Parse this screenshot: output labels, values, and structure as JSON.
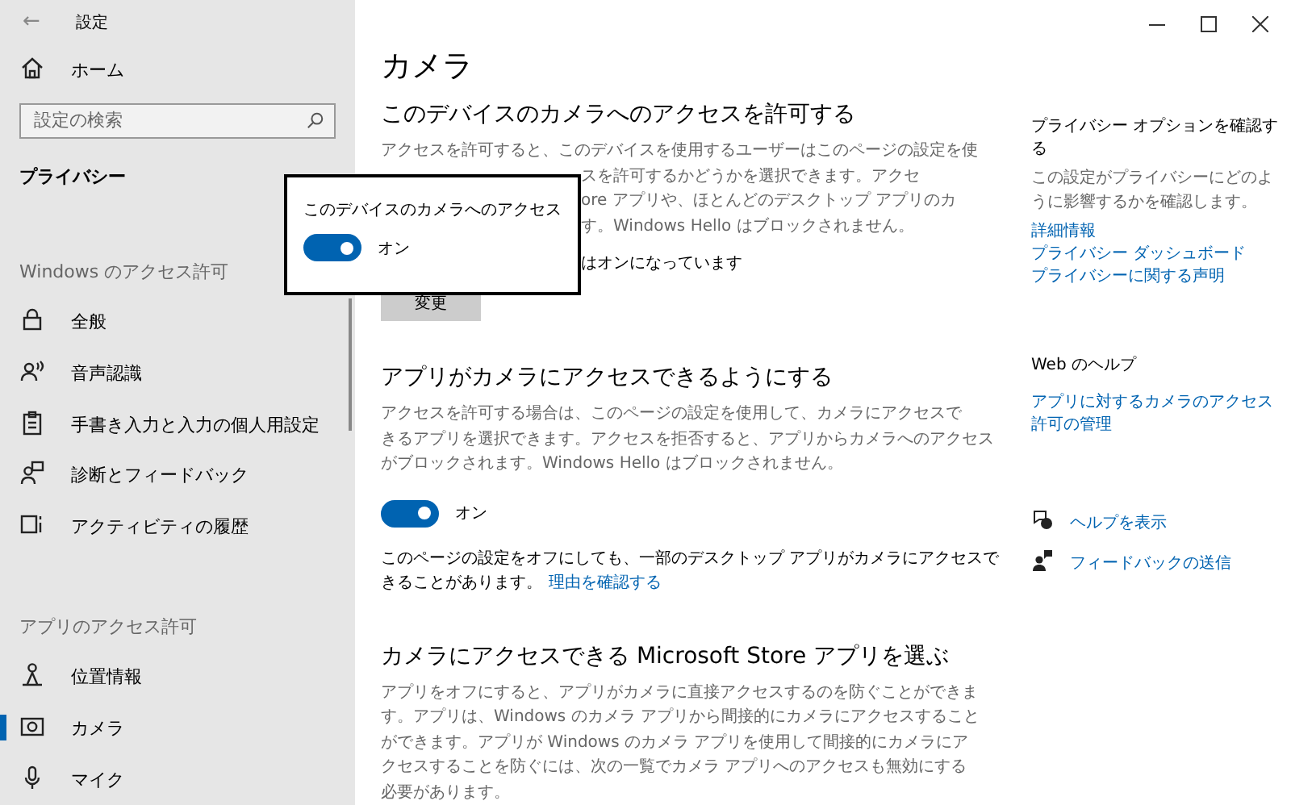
{
  "window": {
    "back": "←",
    "title": "設定"
  },
  "sidebar": {
    "home": "ホーム",
    "search": {
      "placeholder": "設定の検索"
    },
    "category": "プライバシー",
    "groups": [
      {
        "heading": "Windows のアクセス許可",
        "items": [
          {
            "label": "全般",
            "selected": false
          },
          {
            "label": "音声認識",
            "selected": false
          },
          {
            "label": "手書き入力と入力の個人用設定",
            "selected": false
          },
          {
            "label": "診断とフィードバック",
            "selected": false
          },
          {
            "label": "アクティビティの履歴",
            "selected": false
          }
        ]
      },
      {
        "heading": "アプリのアクセス許可",
        "items": [
          {
            "label": "位置情報",
            "selected": false
          },
          {
            "label": "カメラ",
            "selected": true
          },
          {
            "label": "マイク",
            "selected": false
          }
        ]
      }
    ]
  },
  "main": {
    "title": "カメラ",
    "device_access": {
      "heading": "このデバイスのカメラへのアクセスを許可する",
      "first_line": "アクセスを許可すると、このデバイスを使用するユーザーはこのページの設定を使",
      "visible_fragments": [
        "スを許可するかどうかを選択できます。アクセ",
        "ore アプリや、ほとんどのデスクトップ アプリのカ",
        "す。Windows Hello はブロックされません。"
      ],
      "status_fragment": "はオンになっています",
      "button": "変更"
    },
    "app_access": {
      "heading": "アプリがカメラにアクセスできるようにする",
      "description_lines": [
        "アクセスを許可する場合は、このページの設定を使用して、カメラにアクセスで",
        "きるアプリを選択できます。アクセスを拒否すると、アプリからカメラへのアクセス",
        "がブロックされます。Windows Hello はブロックされません。"
      ],
      "toggle": {
        "on": true,
        "label": "オン"
      },
      "note_lines": [
        "このページの設定をオフにしても、一部のデスクトップ アプリがカメラにアクセスで",
        "きることがあります。"
      ],
      "note_link": "理由を確認する"
    },
    "store_apps": {
      "heading": "カメラにアクセスできる Microsoft Store アプリを選ぶ",
      "description_lines": [
        "アプリをオフにすると、アプリがカメラに直接アクセスするのを防ぐことができま",
        "す。アプリは、Windows のカメラ アプリから間接的にカメラにアクセスすること",
        "ができます。アプリが Windows のカメラ アプリを使用して間接的にカメラにア",
        "クセスすることを防ぐには、次の一覧でカメラ アプリへのアクセスも無効にする",
        "必要があります。"
      ]
    }
  },
  "popup": {
    "label": "このデバイスのカメラへのアクセス",
    "toggle": {
      "on": true,
      "label": "オン"
    }
  },
  "right_panel": {
    "privacy": {
      "heading": "プライバシー オプションを確認する",
      "description": "この設定がプライバシーにどのように影響するかを確認します。",
      "links": [
        "詳細情報",
        "プライバシー ダッシュボード",
        "プライバシーに関する声明"
      ]
    },
    "web_help": {
      "heading": "Web のヘルプ",
      "links": [
        "アプリに対するカメラのアクセス許可の管理"
      ]
    },
    "actions": [
      "ヘルプを表示",
      "フィードバックの送信"
    ]
  }
}
